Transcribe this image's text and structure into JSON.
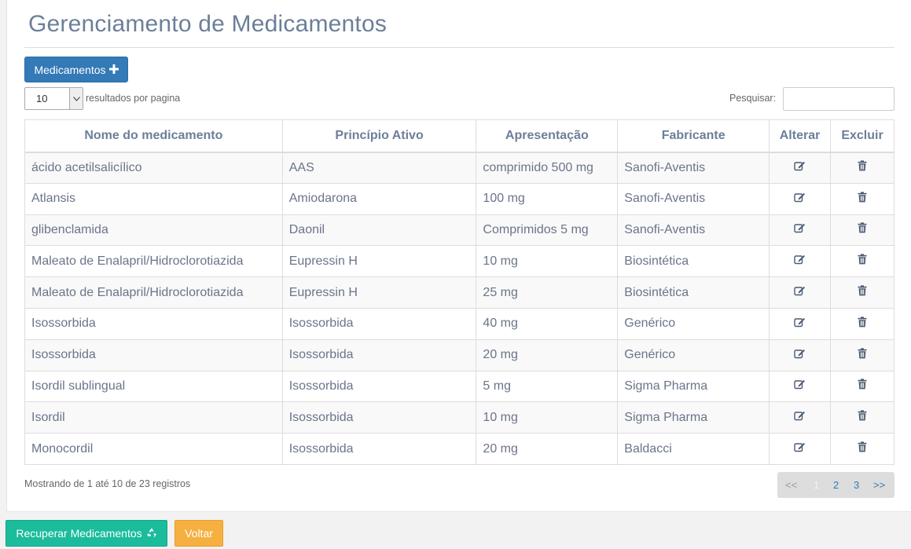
{
  "page": {
    "title": "Gerenciamento de Medicamentos"
  },
  "toolbar": {
    "add_label": "Medicamentos",
    "add_icon": "plus-icon"
  },
  "length": {
    "value": "10",
    "label": "resultados por pagina"
  },
  "search": {
    "label": "Pesquisar:",
    "value": ""
  },
  "table": {
    "columns": [
      "Nome do medicamento",
      "Princípio Ativo",
      "Apresentação",
      "Fabricante",
      "Alterar",
      "Excluir"
    ],
    "rows": [
      [
        "ácido acetilsalicílico",
        "AAS",
        "comprimido 500 mg",
        "Sanofi-Aventis"
      ],
      [
        "Atlansis",
        "Amiodarona",
        "100 mg",
        "Sanofi-Aventis"
      ],
      [
        "glibenclamida",
        "Daonil",
        "Comprimidos 5 mg",
        "Sanofi-Aventis"
      ],
      [
        "Maleato de Enalapril/Hidroclorotiazida",
        "Eupressin H",
        "10 mg",
        "Biosintética"
      ],
      [
        "Maleato de Enalapril/Hidroclorotiazida",
        "Eupressin H",
        "25 mg",
        "Biosintética"
      ],
      [
        "Isossorbida",
        "Isossorbida",
        "40 mg",
        "Genérico"
      ],
      [
        "Isossorbida",
        "Isossorbida",
        "20 mg",
        "Genérico"
      ],
      [
        "Isordil sublingual",
        "Isossorbida",
        "5 mg",
        "Sigma Pharma"
      ],
      [
        "Isordil",
        "Isossorbida",
        "10 mg",
        "Sigma Pharma"
      ],
      [
        "Monocordil",
        "Isossorbida",
        "20 mg",
        "Baldacci"
      ]
    ],
    "edit_icon": "edit-icon",
    "delete_icon": "trash-icon"
  },
  "footer": {
    "info": "Mostrando de 1 até 10 de 23 registros",
    "pagination": {
      "prev": "<<",
      "pages": [
        "1",
        "2",
        "3"
      ],
      "next": ">>",
      "current": "1"
    }
  },
  "actions": {
    "recover_label": "Recuperar Medicamentos",
    "recover_icon": "recycle-icon",
    "back_label": "Voltar"
  },
  "colors": {
    "primary": "#337ab7",
    "success": "#1abc9c",
    "warning": "#f5b041",
    "title": "#6c7f99"
  }
}
